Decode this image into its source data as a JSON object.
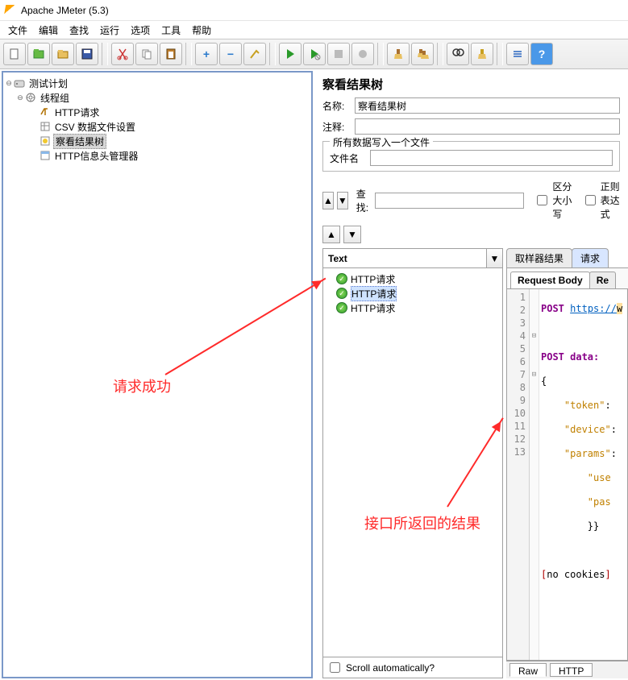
{
  "window": {
    "title": "Apache JMeter (5.3)"
  },
  "menu": [
    "文件",
    "编辑",
    "查找",
    "运行",
    "选项",
    "工具",
    "帮助"
  ],
  "toolbar_icons": [
    {
      "name": "new-file-icon"
    },
    {
      "name": "open-templates-icon"
    },
    {
      "name": "open-icon"
    },
    {
      "name": "save-icon"
    },
    {
      "sep": true
    },
    {
      "name": "cut-icon"
    },
    {
      "name": "copy-icon"
    },
    {
      "name": "paste-icon"
    },
    {
      "sep": true
    },
    {
      "name": "plus-icon"
    },
    {
      "name": "minus-icon"
    },
    {
      "name": "wand-icon"
    },
    {
      "sep": true
    },
    {
      "name": "run-icon"
    },
    {
      "name": "run-no-pause-icon"
    },
    {
      "name": "stop-icon"
    },
    {
      "name": "shutdown-icon"
    },
    {
      "sep": true
    },
    {
      "name": "clear-icon"
    },
    {
      "name": "clear-all-icon"
    },
    {
      "sep": true
    },
    {
      "name": "search-icon"
    },
    {
      "name": "reset-search-icon"
    },
    {
      "sep": true
    },
    {
      "name": "function-helper-icon"
    },
    {
      "name": "help-icon"
    }
  ],
  "tree": {
    "root": "测试计划",
    "thread_group": "线程组",
    "children": [
      "HTTP请求",
      "CSV 数据文件设置",
      "察看结果树",
      "HTTP信息头管理器"
    ],
    "selected": "察看结果树"
  },
  "panel": {
    "title": "察看结果树",
    "name_label": "名称:",
    "name_value": "察看结果树",
    "comment_label": "注释:",
    "comment_value": "",
    "filegroup_title": "所有数据写入一个文件",
    "filename_label": "文件名",
    "filename_value": "",
    "search_label": "查找:",
    "search_value": "",
    "case_label": "区分大小写",
    "regex_label": "正则表达式"
  },
  "results": {
    "dropdown": "Text",
    "items": [
      "HTTP请求",
      "HTTP请求",
      "HTTP请求"
    ],
    "selected_index": 1,
    "scroll_label": "Scroll automatically?"
  },
  "detail": {
    "top_tabs": [
      "取样器结果",
      "请求"
    ],
    "top_active": 1,
    "sub_tabs": [
      "Request Body",
      "Re"
    ],
    "sub_active": 0,
    "code_lines": [
      {
        "n": 1,
        "fold": "",
        "text": "POST https://w",
        "cls": "line1"
      },
      {
        "n": 2,
        "fold": "",
        "text": "",
        "cls": ""
      },
      {
        "n": 3,
        "fold": "",
        "text": "POST data:",
        "cls": ""
      },
      {
        "n": 4,
        "fold": "⊟",
        "text": "{",
        "cls": "brace"
      },
      {
        "n": 5,
        "fold": "",
        "text": "    \"token\":",
        "cls": "str"
      },
      {
        "n": 6,
        "fold": "",
        "text": "    \"device\":",
        "cls": "str"
      },
      {
        "n": 7,
        "fold": "⊟",
        "text": "    \"params\":",
        "cls": "str"
      },
      {
        "n": 8,
        "fold": "",
        "text": "        \"use",
        "cls": "str"
      },
      {
        "n": 9,
        "fold": "",
        "text": "        \"pas",
        "cls": "str"
      },
      {
        "n": 10,
        "fold": "",
        "text": "        }}",
        "cls": "brace"
      },
      {
        "n": 11,
        "fold": "",
        "text": "",
        "cls": ""
      },
      {
        "n": 12,
        "fold": "",
        "text": "[no cookies]",
        "cls": "bracket"
      },
      {
        "n": 13,
        "fold": "",
        "text": "",
        "cls": ""
      }
    ],
    "bottom_tabs": [
      "Raw",
      "HTTP"
    ],
    "bottom_active": 0
  },
  "annotations": {
    "a1": "请求成功",
    "a2": "接口所返回的结果"
  }
}
